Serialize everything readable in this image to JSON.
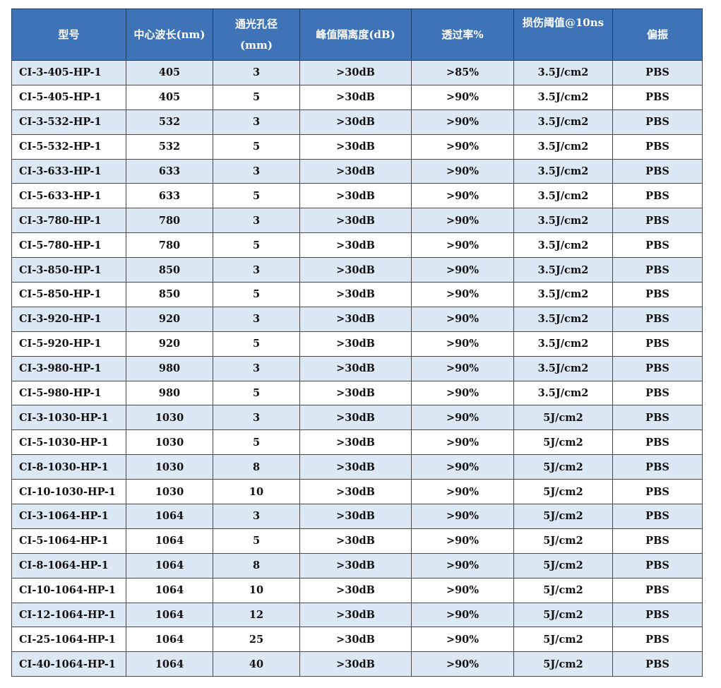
{
  "table": {
    "headers": [
      [
        "型号"
      ],
      [
        "中心波长(nm)"
      ],
      [
        "通光孔径",
        "(mm)"
      ],
      [
        "峰值隔离度(dB)"
      ],
      [
        "透过率%"
      ],
      [
        "损伤阈值@10ns"
      ],
      [
        "偏振"
      ]
    ],
    "rows": [
      [
        "CI-3-405-HP-1",
        "405",
        "3",
        ">30dB",
        ">85%",
        "3.5J/cm2",
        "PBS"
      ],
      [
        "CI-5-405-HP-1",
        "405",
        "5",
        ">30dB",
        ">90%",
        "3.5J/cm2",
        "PBS"
      ],
      [
        "CI-3-532-HP-1",
        "532",
        "3",
        ">30dB",
        ">90%",
        "3.5J/cm2",
        "PBS"
      ],
      [
        "CI-5-532-HP-1",
        "532",
        "5",
        ">30dB",
        ">90%",
        "3.5J/cm2",
        "PBS"
      ],
      [
        "CI-3-633-HP-1",
        "633",
        "3",
        ">30dB",
        ">90%",
        "3.5J/cm2",
        "PBS"
      ],
      [
        "CI-5-633-HP-1",
        "633",
        "5",
        ">30dB",
        ">90%",
        "3.5J/cm2",
        "PBS"
      ],
      [
        "CI-3-780-HP-1",
        "780",
        "3",
        ">30dB",
        ">90%",
        "3.5J/cm2",
        "PBS"
      ],
      [
        "CI-5-780-HP-1",
        "780",
        "5",
        ">30dB",
        ">90%",
        "3.5J/cm2",
        "PBS"
      ],
      [
        "CI-3-850-HP-1",
        "850",
        "3",
        ">30dB",
        ">90%",
        "3.5J/cm2",
        "PBS"
      ],
      [
        "CI-5-850-HP-1",
        "850",
        "5",
        ">30dB",
        ">90%",
        "3.5J/cm2",
        "PBS"
      ],
      [
        "CI-3-920-HP-1",
        "920",
        "3",
        ">30dB",
        ">90%",
        "3.5J/cm2",
        "PBS"
      ],
      [
        "CI-5-920-HP-1",
        "920",
        "5",
        ">30dB",
        ">90%",
        "3.5J/cm2",
        "PBS"
      ],
      [
        "CI-3-980-HP-1",
        "980",
        "3",
        ">30dB",
        ">90%",
        "3.5J/cm2",
        "PBS"
      ],
      [
        "CI-5-980-HP-1",
        "980",
        "5",
        ">30dB",
        ">90%",
        "3.5J/cm2",
        "PBS"
      ],
      [
        "CI-3-1030-HP-1",
        "1030",
        "3",
        ">30dB",
        ">90%",
        "5J/cm2",
        "PBS"
      ],
      [
        "CI-5-1030-HP-1",
        "1030",
        "5",
        ">30dB",
        ">90%",
        "5J/cm2",
        "PBS"
      ],
      [
        "CI-8-1030-HP-1",
        "1030",
        "8",
        ">30dB",
        ">90%",
        "5J/cm2",
        "PBS"
      ],
      [
        "CI-10-1030-HP-1",
        "1030",
        "10",
        ">30dB",
        ">90%",
        "5J/cm2",
        "PBS"
      ],
      [
        "CI-3-1064-HP-1",
        "1064",
        "3",
        ">30dB",
        ">90%",
        "5J/cm2",
        "PBS"
      ],
      [
        "CI-5-1064-HP-1",
        "1064",
        "5",
        ">30dB",
        ">90%",
        "5J/cm2",
        "PBS"
      ],
      [
        "CI-8-1064-HP-1",
        "1064",
        "8",
        ">30dB",
        ">90%",
        "5J/cm2",
        "PBS"
      ],
      [
        "CI-10-1064-HP-1",
        "1064",
        "10",
        ">30dB",
        ">90%",
        "5J/cm2",
        "PBS"
      ],
      [
        "CI-12-1064-HP-1",
        "1064",
        "12",
        ">30dB",
        ">90%",
        "5J/cm2",
        "PBS"
      ],
      [
        "CI-25-1064-HP-1",
        "1064",
        "25",
        ">30dB",
        ">90%",
        "5J/cm2",
        "PBS"
      ],
      [
        "CI-40-1064-HP-1",
        "1064",
        "40",
        ">30dB",
        ">90%",
        "5J/cm2",
        "PBS"
      ]
    ]
  },
  "colors": {
    "header_bg": "#3f73b8",
    "header_text": "#ffffff",
    "band_row": "#dce8f4",
    "plain_row": "#ffffff",
    "border": "#4a4a4a"
  }
}
